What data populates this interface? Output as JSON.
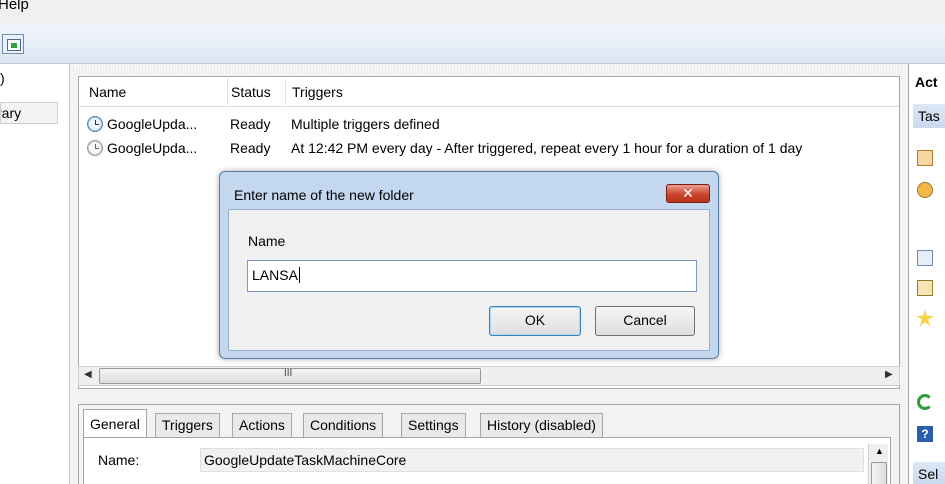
{
  "menubar": {
    "help_label": "Help"
  },
  "left_tree": {
    "item_partial": ")",
    "library_label": "rary"
  },
  "task_list": {
    "columns": [
      "Name",
      "Status",
      "Triggers"
    ],
    "rows": [
      {
        "name": "GoogleUpda...",
        "status": "Ready",
        "triggers": "Multiple triggers defined"
      },
      {
        "name": "GoogleUpda...",
        "status": "Ready",
        "triggers": "At 12:42 PM every day - After triggered, repeat every 1 hour for a duration of 1 day"
      }
    ]
  },
  "scroll": {
    "grip": "III"
  },
  "detail": {
    "tabs": [
      "General",
      "Triggers",
      "Actions",
      "Conditions",
      "Settings",
      "History (disabled)"
    ],
    "name_label": "Name:",
    "name_value": "GoogleUpdateTaskMachineCore"
  },
  "actions_pane": {
    "title": "Act",
    "section_label": "Tas",
    "selected_label": "Sel",
    "help_glyph": "?"
  },
  "dialog": {
    "title": "Enter name of the new folder",
    "close_glyph": "✕",
    "name_label": "Name",
    "name_value": "LANSA",
    "ok_label": "OK",
    "cancel_label": "Cancel"
  }
}
